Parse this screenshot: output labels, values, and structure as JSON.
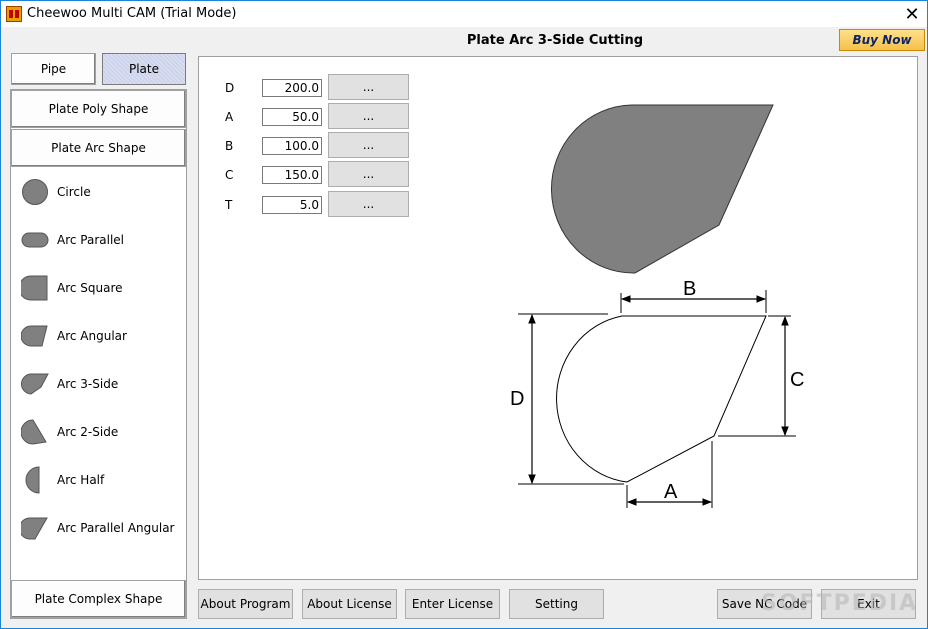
{
  "window": {
    "title": "Cheewoo Multi CAM (Trial Mode)"
  },
  "tabs": {
    "pipe": "Pipe",
    "plate": "Plate"
  },
  "sidebar": {
    "groups": {
      "poly": "Plate Poly Shape",
      "arc": "Plate Arc Shape",
      "complex": "Plate Complex Shape"
    },
    "items": [
      {
        "label": "Circle",
        "icon": "circle-icon"
      },
      {
        "label": "Arc Parallel",
        "icon": "arc-parallel-icon"
      },
      {
        "label": "Arc Square",
        "icon": "arc-square-icon"
      },
      {
        "label": "Arc Angular",
        "icon": "arc-angular-icon"
      },
      {
        "label": "Arc 3-Side",
        "icon": "arc-3-side-icon"
      },
      {
        "label": "Arc 2-Side",
        "icon": "arc-2-side-icon"
      },
      {
        "label": "Arc Half",
        "icon": "arc-half-icon"
      },
      {
        "label": "Arc Parallel Angular",
        "icon": "arc-parallel-angular-icon"
      }
    ]
  },
  "header": {
    "title": "Plate  Arc 3-Side Cutting",
    "buy_now": "Buy Now"
  },
  "params": [
    {
      "label": "D",
      "value": "200.0",
      "button": "..."
    },
    {
      "label": "A",
      "value": "50.0",
      "button": "..."
    },
    {
      "label": "B",
      "value": "100.0",
      "button": "..."
    },
    {
      "label": "C",
      "value": "150.0",
      "button": "..."
    },
    {
      "label": "T",
      "value": "5.0",
      "button": "..."
    }
  ],
  "diagram": {
    "label_b": "B",
    "label_c": "C",
    "label_d": "D",
    "label_a": "A"
  },
  "footer": {
    "about_program": "About Program",
    "about_license": "About License",
    "enter_license": "Enter License",
    "setting": "Setting",
    "save_nc": "Save NC Code",
    "exit": "Exit"
  },
  "watermark": "SOFTPEDIA",
  "colors": {
    "shape_fill": "#808080",
    "accent": "#f5c14a",
    "title_border": "#1883d7"
  }
}
